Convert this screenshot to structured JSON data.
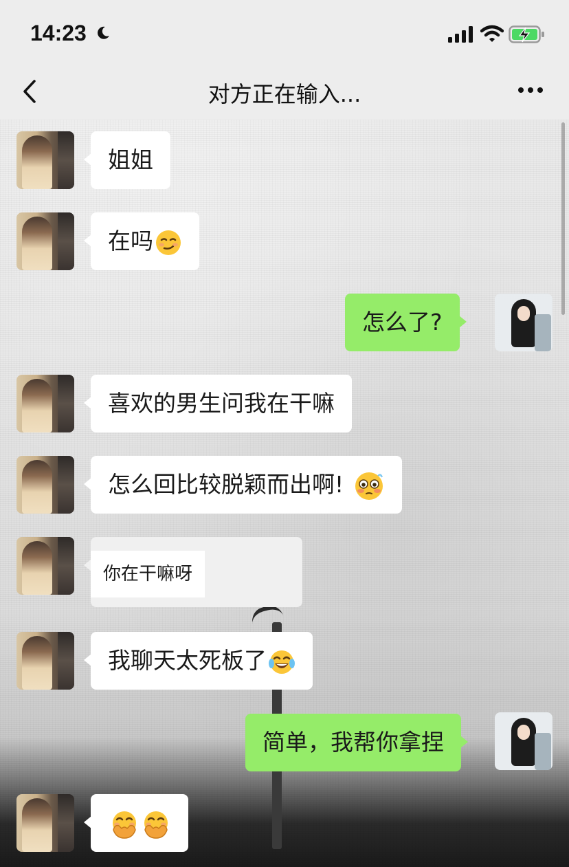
{
  "status_bar": {
    "time": "14:23",
    "moon_icon": "moon-icon",
    "signal_icon": "signal-bars-icon",
    "wifi_icon": "wifi-icon",
    "battery_icon": "battery-charging-icon"
  },
  "nav": {
    "title": "对方正在输入...",
    "back_icon": "chevron-left-icon",
    "more_icon": "more-dots-icon"
  },
  "messages": [
    {
      "side": "left",
      "text": "姐姐"
    },
    {
      "side": "left",
      "text": "在吗",
      "emoji": "smirk-face"
    },
    {
      "side": "right",
      "text": "怎么了?"
    },
    {
      "side": "left",
      "text": "喜欢的男生问我在干嘛"
    },
    {
      "side": "left",
      "text": "怎么回比较脱颖而出啊!",
      "emoji": "flushed-face"
    },
    {
      "side": "left",
      "text": "你在干嘛呀",
      "type": "quote-image"
    },
    {
      "side": "left",
      "text": "我聊天太死板了",
      "emoji": "tears-of-joy-face"
    },
    {
      "side": "right",
      "text": "简单，我帮你拿捏"
    },
    {
      "side": "left",
      "text": "",
      "emoji": "hand-over-mouth-face x2"
    }
  ],
  "colors": {
    "self_bubble": "#95ec69",
    "other_bubble": "#ffffff",
    "nav_background": "#ededed"
  }
}
